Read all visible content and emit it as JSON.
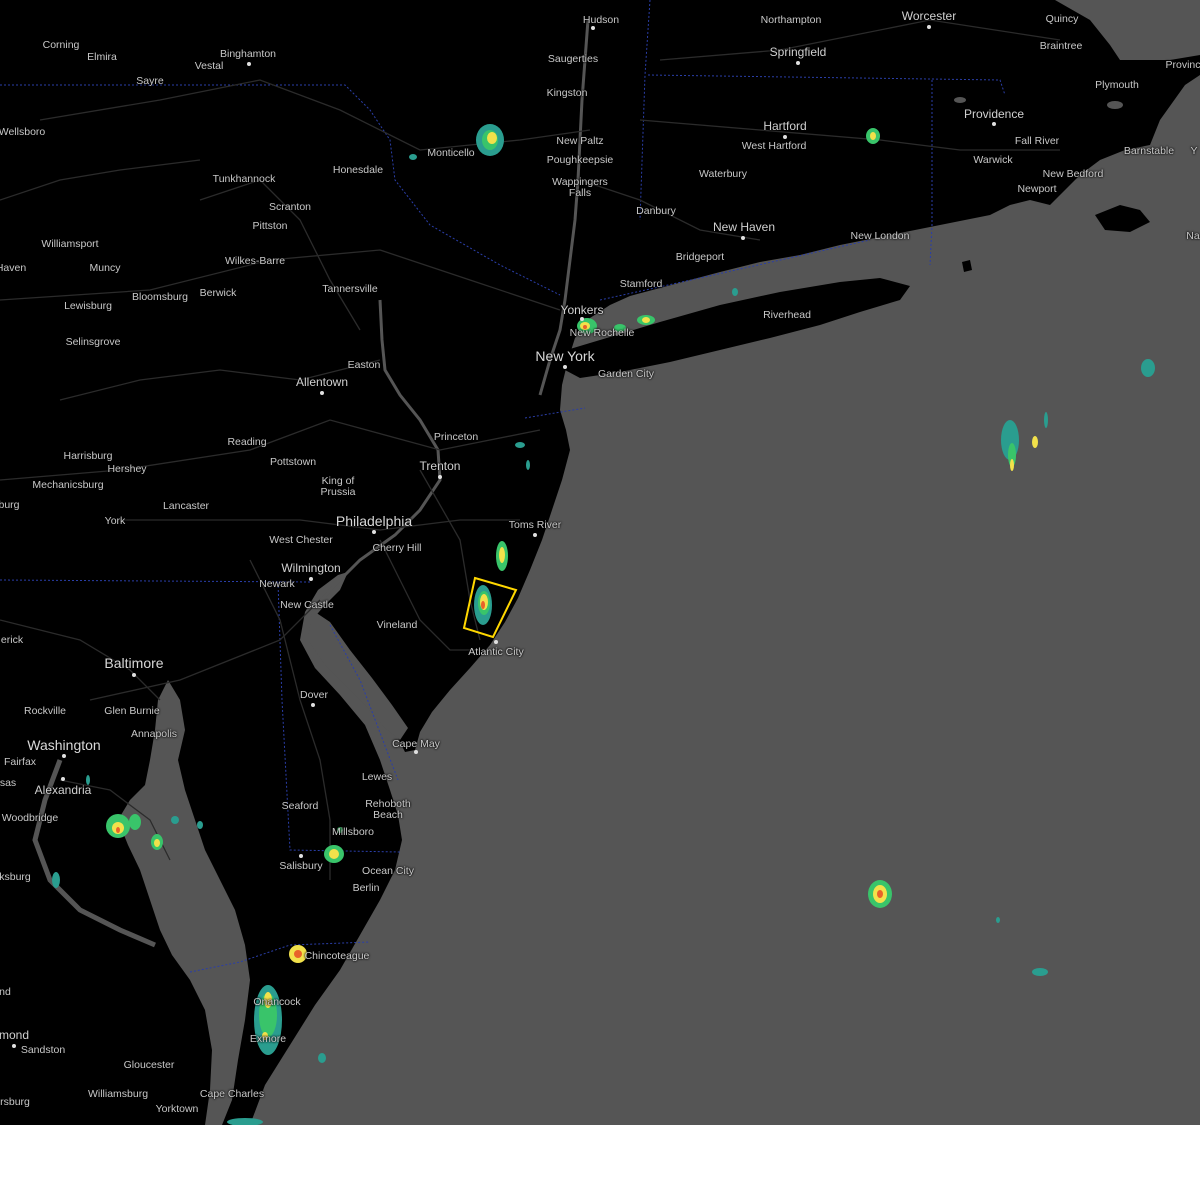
{
  "map": {
    "colors": {
      "land": "#000000",
      "water": "#555555",
      "roads": "#2e2e2e",
      "state_border": "#1f2f8f",
      "warning_polygon": "#ffd700",
      "radar_low": "#2a9d8f",
      "radar_mid": "#39c46a",
      "radar_high": "#f2e14b",
      "radar_peak": "#e8622a"
    },
    "cities": [
      {
        "name": "Hudson"
      },
      {
        "name": "Northampton"
      },
      {
        "name": "Worcester"
      },
      {
        "name": "Quincy"
      },
      {
        "name": "Corning"
      },
      {
        "name": "Elmira"
      },
      {
        "name": "Binghamton"
      },
      {
        "name": "Vestal"
      },
      {
        "name": "Saugerties"
      },
      {
        "name": "Springfield"
      },
      {
        "name": "Braintree"
      },
      {
        "name": "Provinc"
      },
      {
        "name": "Sayre"
      },
      {
        "name": "Kingston"
      },
      {
        "name": "Plymouth"
      },
      {
        "name": "Wellsboro"
      },
      {
        "name": "Hartford"
      },
      {
        "name": "Providence"
      },
      {
        "name": "Fall River"
      },
      {
        "name": "New Paltz"
      },
      {
        "name": "Monticello"
      },
      {
        "name": "West Hartford"
      },
      {
        "name": "Barnstable"
      },
      {
        "name": "Y"
      },
      {
        "name": "Poughkeepsie"
      },
      {
        "name": "Warwick"
      },
      {
        "name": "Honesdale"
      },
      {
        "name": "New Bedford"
      },
      {
        "name": "Waterbury"
      },
      {
        "name": "Tunkhannock"
      },
      {
        "name": "Wappingers Falls"
      },
      {
        "name": "Newport"
      },
      {
        "name": "Scranton"
      },
      {
        "name": "Danbury"
      },
      {
        "name": "New Haven"
      },
      {
        "name": "Pittston"
      },
      {
        "name": "New London"
      },
      {
        "name": "Na"
      },
      {
        "name": "Williamsport"
      },
      {
        "name": "Bridgeport"
      },
      {
        "name": "Wilkes-Barre"
      },
      {
        "name": "Haven"
      },
      {
        "name": "Muncy"
      },
      {
        "name": "Stamford"
      },
      {
        "name": "Tannersville"
      },
      {
        "name": "Bloomsburg"
      },
      {
        "name": "Berwick"
      },
      {
        "name": "Lewisburg"
      },
      {
        "name": "Yonkers"
      },
      {
        "name": "Riverhead"
      },
      {
        "name": "New Rochelle"
      },
      {
        "name": "Selinsgrove"
      },
      {
        "name": "New York"
      },
      {
        "name": "Easton"
      },
      {
        "name": "Garden City"
      },
      {
        "name": "Allentown"
      },
      {
        "name": "Princeton"
      },
      {
        "name": "Reading"
      },
      {
        "name": "Harrisburg"
      },
      {
        "name": "Hershey"
      },
      {
        "name": "Pottstown"
      },
      {
        "name": "Trenton"
      },
      {
        "name": "Mechanicsburg"
      },
      {
        "name": "King of Prussia"
      },
      {
        "name": "burg"
      },
      {
        "name": "Lancaster"
      },
      {
        "name": "York"
      },
      {
        "name": "Philadelphia"
      },
      {
        "name": "Toms River"
      },
      {
        "name": "West Chester"
      },
      {
        "name": "Cherry Hill"
      },
      {
        "name": "Wilmington"
      },
      {
        "name": "Newark"
      },
      {
        "name": "New Castle"
      },
      {
        "name": "Vineland"
      },
      {
        "name": "erick"
      },
      {
        "name": "Atlantic City"
      },
      {
        "name": "Baltimore"
      },
      {
        "name": "Dover"
      },
      {
        "name": "Rockville"
      },
      {
        "name": "Glen Burnie"
      },
      {
        "name": "Annapolis"
      },
      {
        "name": "Cape May"
      },
      {
        "name": "Washington"
      },
      {
        "name": "Fairfax"
      },
      {
        "name": "Lewes"
      },
      {
        "name": "Alexandria"
      },
      {
        "name": "sas"
      },
      {
        "name": "Rehoboth Beach"
      },
      {
        "name": "Seaford"
      },
      {
        "name": "Woodbridge"
      },
      {
        "name": "Millsboro"
      },
      {
        "name": "Salisbury"
      },
      {
        "name": "Ocean City"
      },
      {
        "name": "ksburg"
      },
      {
        "name": "Berlin"
      },
      {
        "name": "Chincoteague"
      },
      {
        "name": "nd"
      },
      {
        "name": "Onancock"
      },
      {
        "name": "Exmore"
      },
      {
        "name": "mond"
      },
      {
        "name": "Sandston"
      },
      {
        "name": "Gloucester"
      },
      {
        "name": "Williamsburg"
      },
      {
        "name": "Cape Charles"
      },
      {
        "name": "rsburg"
      },
      {
        "name": "Yorktown"
      }
    ]
  }
}
